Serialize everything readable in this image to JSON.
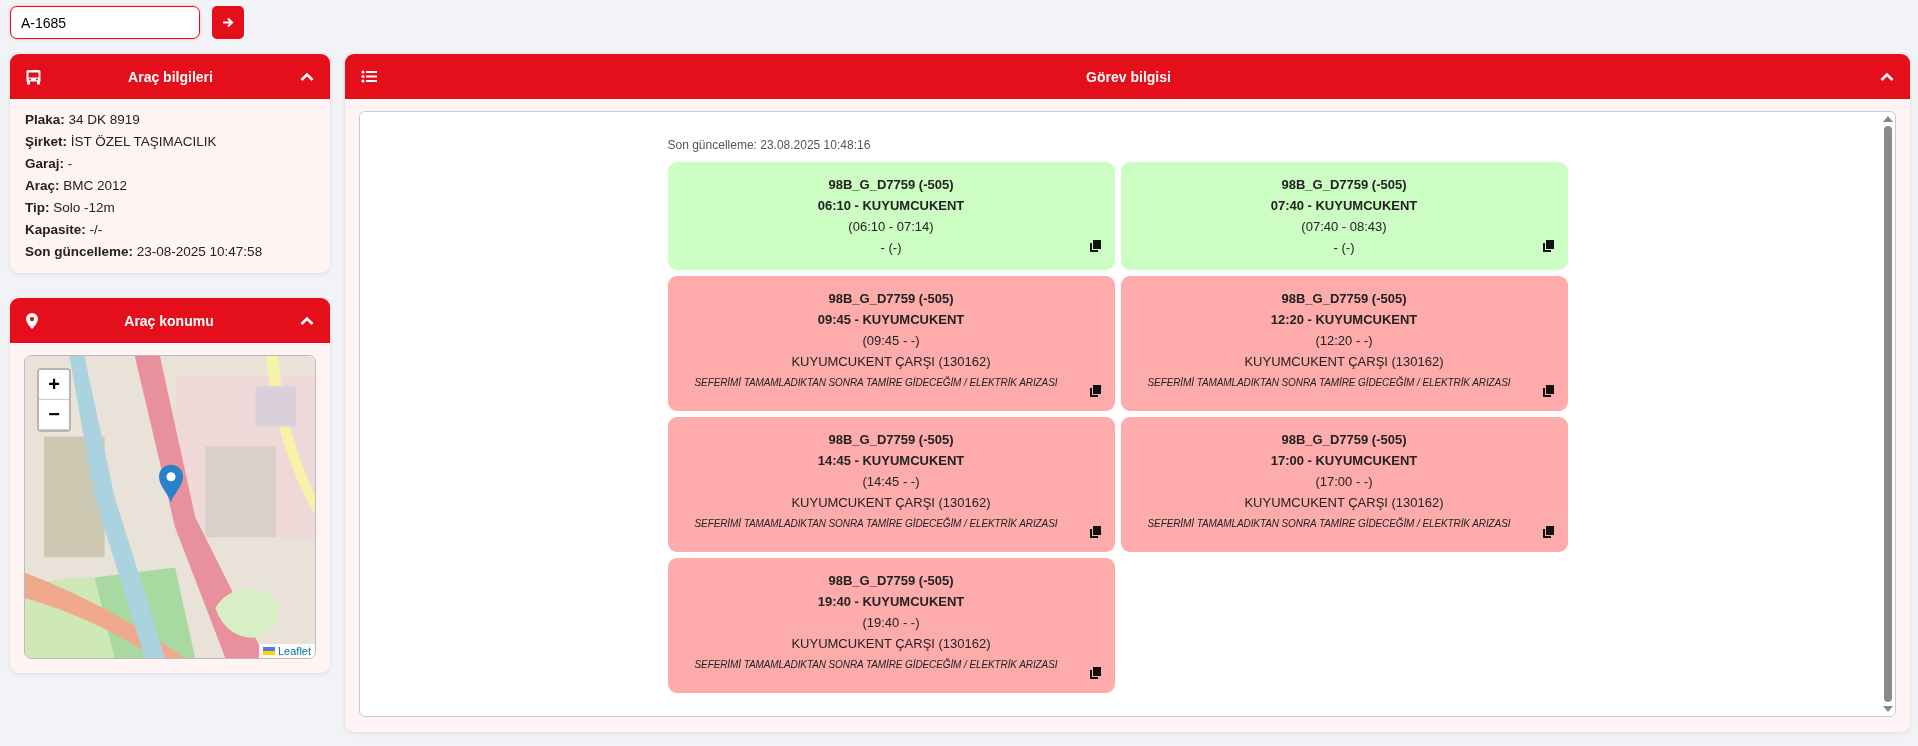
{
  "search": {
    "value": "A-1685"
  },
  "vehicle_panel": {
    "title": "Araç bilgileri",
    "expanded": true,
    "fields": [
      "**Plaka:** 34 DK 8919",
      "**Şirket:** İST ÖZEL TAŞIMACILIK",
      "**Garaj:** -",
      "**Araç:** BMC 2012",
      "**Tip:** Solo -12m",
      "**Kapasite:** -/-",
      "**Son güncelleme:** 23-08-2025 10:47:58"
    ]
  },
  "location_panel": {
    "title": "Araç konumu",
    "expanded": true,
    "map": {
      "kind": "picture",
      "zoom_in": "+",
      "zoom_out": "−",
      "attribution": "Leaflet"
    }
  },
  "task_panel": {
    "title": "Görev bilgisi",
    "expanded": true,
    "last_update": "Son güncelleme: 23.08.2025 10:48:16",
    "tasks": [
      {
        "kind": "completed",
        "route": "98B_G_D7759 (-505)",
        "trip": "06:10 - KUYUMCUKENT",
        "time_range": "(06:10 - 07:14)",
        "stop": "- (-)"
      },
      {
        "kind": "completed",
        "route": "98B_G_D7759 (-505)",
        "trip": "07:40 - KUYUMCUKENT",
        "time_range": "(07:40 - 08:43)",
        "stop": "- (-)"
      },
      {
        "kind": "failed",
        "route": "98B_G_D7759 (-505)",
        "trip": "09:45 - KUYUMCUKENT",
        "time_range": "(09:45 - -)",
        "stop": "KUYUMCUKENT ÇARŞI (130162)",
        "note": "SEFERİMİ TAMAMLADIKTAN SONRA TAMİRE GİDECEĞİM / ELEKTRİK ARIZASI"
      },
      {
        "kind": "failed",
        "route": "98B_G_D7759 (-505)",
        "trip": "12:20 - KUYUMCUKENT",
        "time_range": "(12:20 - -)",
        "stop": "KUYUMCUKENT ÇARŞI (130162)",
        "note": "SEFERİMİ TAMAMLADIKTAN SONRA TAMİRE GİDECEĞİM / ELEKTRİK ARIZASI"
      },
      {
        "kind": "failed",
        "route": "98B_G_D7759 (-505)",
        "trip": "14:45 - KUYUMCUKENT",
        "time_range": "(14:45 - -)",
        "stop": "KUYUMCUKENT ÇARŞI (130162)",
        "note": "SEFERİMİ TAMAMLADIKTAN SONRA TAMİRE GİDECEĞİM / ELEKTRİK ARIZASI"
      },
      {
        "kind": "failed",
        "route": "98B_G_D7759 (-505)",
        "trip": "17:00 - KUYUMCUKENT",
        "time_range": "(17:00 - -)",
        "stop": "KUYUMCUKENT ÇARŞI (130162)",
        "note": "SEFERİMİ TAMAMLADIKTAN SONRA TAMİRE GİDECEĞİM / ELEKTRİK ARIZASI"
      },
      {
        "kind": "failed",
        "route": "98B_G_D7759 (-505)",
        "trip": "19:40 - KUYUMCUKENT",
        "time_range": "(19:40 - -)",
        "stop": "KUYUMCUKENT ÇARŞI (130162)",
        "note": "SEFERİMİ TAMAMLADIKTAN SONRA TAMİRE GİDECEĞİM / ELEKTRİK ARIZASI"
      }
    ]
  }
}
